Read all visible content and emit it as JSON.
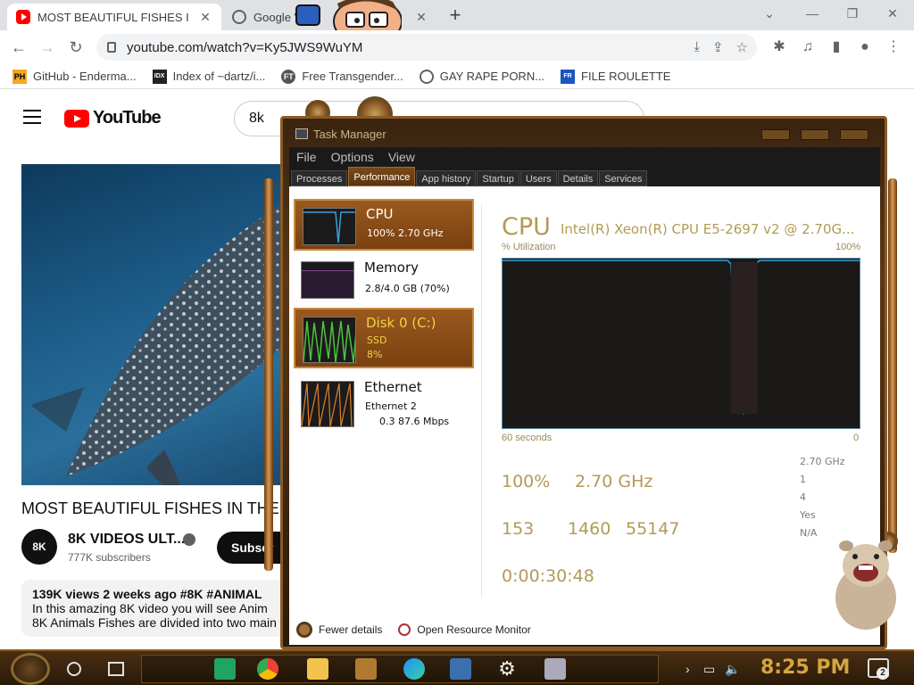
{
  "browser": {
    "tabs": [
      {
        "title": "MOST BEAUTIFUL FISHES I",
        "favicon": "youtube-icon",
        "active": true
      },
      {
        "title": "Google V",
        "favicon": "google-icon",
        "active": false
      }
    ],
    "url": "youtube.com/watch?v=Ky5JWS9WuYM",
    "bookmarks": [
      {
        "label": "GitHub - Enderma...",
        "icon": "PH"
      },
      {
        "label": "Index of ~dartz/i...",
        "icon": "IDX"
      },
      {
        "label": "Free Transgender...",
        "icon": "FT"
      },
      {
        "label": "GAY RAPE PORN...",
        "icon": "globe-icon"
      },
      {
        "label": "FILE ROULETTE",
        "icon": "FR"
      }
    ]
  },
  "youtube": {
    "logo_text": "YouTube",
    "search_value": "8k",
    "video_title": "MOST BEAUTIFUL FISHES IN THE",
    "channel": {
      "avatar_text": "8K",
      "name": "8K VIDEOS ULT...",
      "subscribers": "777K subscribers",
      "subscribe_label": "Subscr"
    },
    "description": {
      "meta": "139K views  2 weeks ago  #8K #ANIMAL",
      "lines": [
        "In this amazing 8K video you will see Anim",
        "8K  Animals Fishes are divided into two main"
      ]
    }
  },
  "task_manager": {
    "title": "Task Manager",
    "menu": [
      "File",
      "Options",
      "View"
    ],
    "tabs": [
      "Processes",
      "Performance",
      "App history",
      "Startup",
      "Users",
      "Details",
      "Services"
    ],
    "selected_tab": "Performance",
    "resources": [
      {
        "name": "CPU",
        "sub1": "100%  2.70 GHz",
        "sub2": ""
      },
      {
        "name": "Memory",
        "sub1": "2.8/4.0 GB (70%)",
        "sub2": ""
      },
      {
        "name": "Disk 0 (C:)",
        "sub1": "SSD",
        "sub2": "8%"
      },
      {
        "name": "Ethernet",
        "sub1": "Ethernet 2",
        "sub2": "0.3      87.6 Mbps"
      }
    ],
    "cpu": {
      "heading": "CPU",
      "model": "Intel(R) Xeon(R) CPU E5-2697 v2 @ 2.70G...",
      "util_label": "% Utilization",
      "util_max": "100%",
      "time_left": "60 seconds",
      "time_right": "0",
      "utilization": "100%",
      "speed": "2.70 GHz",
      "processes": "153",
      "threads": "1460",
      "handles": "55147",
      "uptime": "0:00:30:48",
      "right_stats": [
        "2.70 GHz",
        "1",
        "4",
        "Yes",
        "N/A"
      ]
    },
    "footer": {
      "fewer_details": "Fewer details",
      "resource_monitor": "Open Resource Monitor"
    }
  },
  "taskbar": {
    "clock": "8:25 PM",
    "notification_count": "2"
  },
  "colors": {
    "youtube_red": "#ff0000",
    "tm_accent": "#b39a55",
    "graph_line": "#3aa0d8",
    "clock": "#d4a640"
  }
}
